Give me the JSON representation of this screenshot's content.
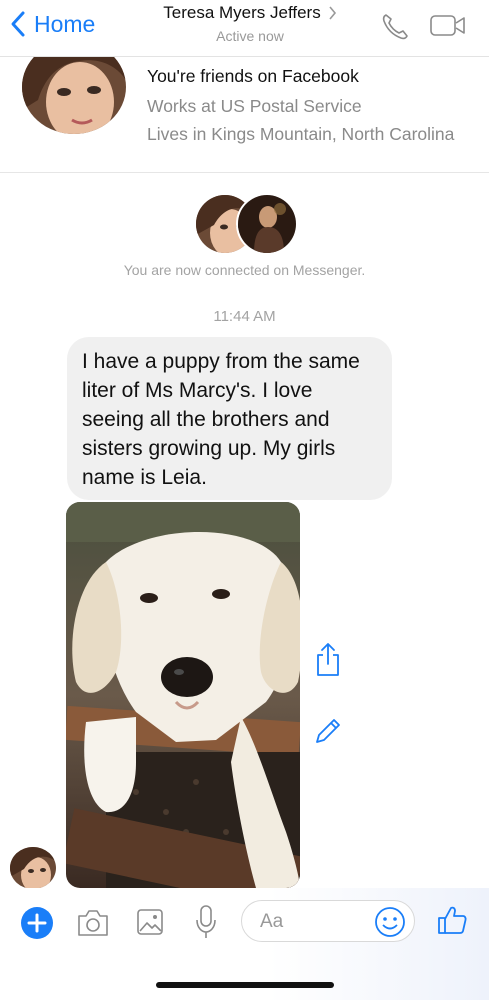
{
  "header": {
    "back_label": "Home",
    "contact_name": "Teresa Myers Jeffers",
    "status": "Active now"
  },
  "profile": {
    "line1": "You're friends on Facebook",
    "line2": "Works at US Postal Service",
    "line3": "Lives in Kings Mountain, North Carolina"
  },
  "thread": {
    "connected_text": "You are now connected on Messenger.",
    "timestamp": "11:44 AM",
    "message_lines": [
      "I have a puppy from the same",
      "liter of Ms Marcy's. I love",
      "seeing all the brothers and",
      "sisters growing up. My girls",
      "name is Leia."
    ]
  },
  "composer": {
    "placeholder": "Aa"
  },
  "colors": {
    "accent": "#1a7ef8",
    "bubble": "#f0f0f0",
    "muted": "#999999"
  },
  "icons": [
    "chevron-left-icon",
    "chevron-right-icon",
    "phone-icon",
    "video-icon",
    "share-icon",
    "edit-icon",
    "plus-icon",
    "camera-icon",
    "image-icon",
    "mic-icon",
    "emoji-icon",
    "thumbs-up-icon"
  ]
}
